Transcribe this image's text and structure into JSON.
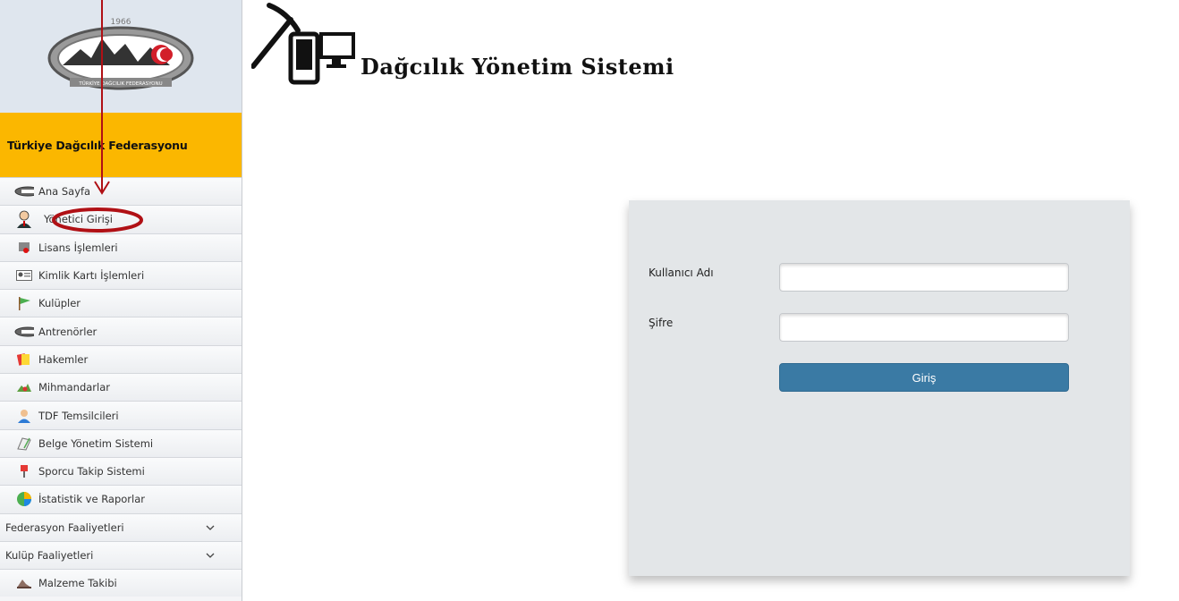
{
  "logo": {
    "year": "1966",
    "caption": "TÜRKİYE DAĞCILIK FEDERASYONU"
  },
  "sidebar": {
    "org_name": "Türkiye Dağcılık Federasyonu",
    "items": [
      {
        "label": "Ana Sayfa",
        "icon": "badge-logo-icon"
      },
      {
        "label": "Yönetici Girişi",
        "icon": "admin-user-icon"
      },
      {
        "label": "Lisans İşlemleri",
        "icon": "license-icon"
      },
      {
        "label": "Kimlik Kartı İşlemleri",
        "icon": "id-card-icon"
      },
      {
        "label": "Kulüpler",
        "icon": "flag-icon"
      },
      {
        "label": "Antrenörler",
        "icon": "badge-logo-icon"
      },
      {
        "label": "Hakemler",
        "icon": "referee-card-icon"
      },
      {
        "label": "Mihmandarlar",
        "icon": "guide-icon"
      },
      {
        "label": "TDF Temsilcileri",
        "icon": "representative-icon"
      },
      {
        "label": "Belge Yönetim Sistemi",
        "icon": "document-icon"
      },
      {
        "label": "Sporcu Takip Sistemi",
        "icon": "athlete-icon"
      },
      {
        "label": "İstatistik ve Raporlar",
        "icon": "pie-chart-icon"
      },
      {
        "label": "Federasyon Faaliyetleri",
        "icon": "chevron-down-icon"
      },
      {
        "label": "Kulüp Faaliyetleri",
        "icon": "chevron-down-icon"
      },
      {
        "label": "Malzeme Takibi",
        "icon": "equipment-icon"
      }
    ]
  },
  "header": {
    "title": "Dağcılık Yönetim Sistemi"
  },
  "login": {
    "username_label": "Kullanıcı Adı",
    "username_value": "",
    "password_label": "Şifre",
    "password_value": "",
    "submit_label": "Giriş"
  },
  "colors": {
    "accent": "#fbb700",
    "button": "#3a7aa4",
    "annotation": "#b01015"
  }
}
